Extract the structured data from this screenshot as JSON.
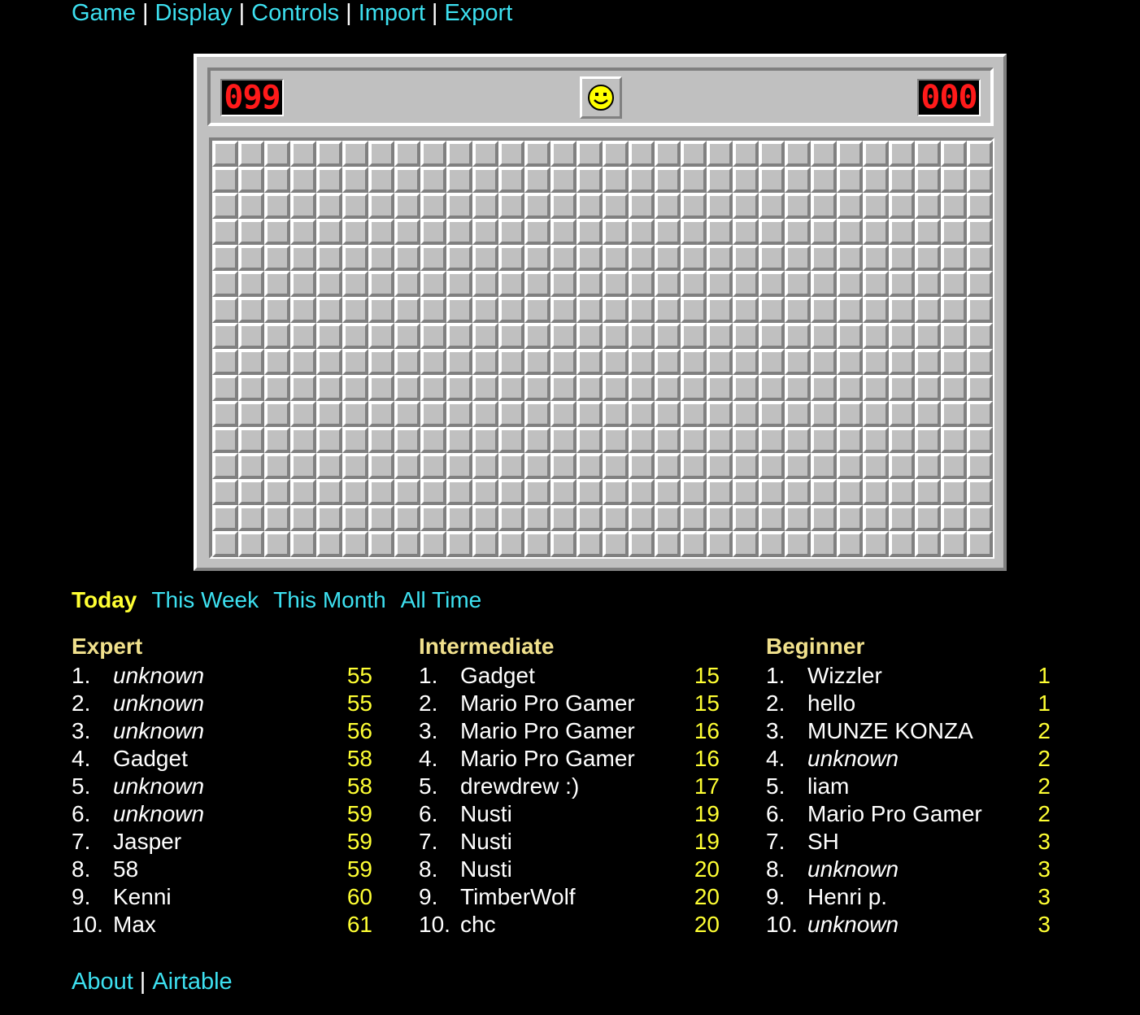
{
  "nav": {
    "items": [
      "Game",
      "Display",
      "Controls",
      "Import",
      "Export"
    ],
    "separator": "|"
  },
  "game": {
    "mines_counter": "099",
    "timer": "000",
    "face": "smiley-face-icon",
    "rows": 16,
    "cols": 30
  },
  "periods": {
    "today": "Today",
    "week": "This Week",
    "month": "This Month",
    "all": "All Time",
    "active": "Today"
  },
  "leaderboards": [
    {
      "title": "Expert",
      "entries": [
        {
          "rank": "1.",
          "name": "unknown",
          "time": "55",
          "unknown": true
        },
        {
          "rank": "2.",
          "name": "unknown",
          "time": "55",
          "unknown": true
        },
        {
          "rank": "3.",
          "name": "unknown",
          "time": "56",
          "unknown": true
        },
        {
          "rank": "4.",
          "name": "Gadget",
          "time": "58",
          "unknown": false
        },
        {
          "rank": "5.",
          "name": "unknown",
          "time": "58",
          "unknown": true
        },
        {
          "rank": "6.",
          "name": "unknown",
          "time": "59",
          "unknown": true
        },
        {
          "rank": "7.",
          "name": "Jasper",
          "time": "59",
          "unknown": false
        },
        {
          "rank": "8.",
          "name": "58",
          "time": "59",
          "unknown": false
        },
        {
          "rank": "9.",
          "name": "Kenni",
          "time": "60",
          "unknown": false
        },
        {
          "rank": "10.",
          "name": "Max",
          "time": "61",
          "unknown": false
        }
      ]
    },
    {
      "title": "Intermediate",
      "entries": [
        {
          "rank": "1.",
          "name": "Gadget",
          "time": "15",
          "unknown": false
        },
        {
          "rank": "2.",
          "name": "Mario Pro Gamer",
          "time": "15",
          "unknown": false
        },
        {
          "rank": "3.",
          "name": "Mario Pro Gamer",
          "time": "16",
          "unknown": false
        },
        {
          "rank": "4.",
          "name": "Mario Pro Gamer",
          "time": "16",
          "unknown": false
        },
        {
          "rank": "5.",
          "name": "drewdrew :)",
          "time": "17",
          "unknown": false
        },
        {
          "rank": "6.",
          "name": "Nusti",
          "time": "19",
          "unknown": false
        },
        {
          "rank": "7.",
          "name": "Nusti",
          "time": "19",
          "unknown": false
        },
        {
          "rank": "8.",
          "name": "Nusti",
          "time": "20",
          "unknown": false
        },
        {
          "rank": "9.",
          "name": "TimberWolf",
          "time": "20",
          "unknown": false
        },
        {
          "rank": "10.",
          "name": "chc",
          "time": "20",
          "unknown": false
        }
      ]
    },
    {
      "title": "Beginner",
      "entries": [
        {
          "rank": "1.",
          "name": "Wizzler",
          "time": "1",
          "unknown": false
        },
        {
          "rank": "2.",
          "name": "hello",
          "time": "1",
          "unknown": false
        },
        {
          "rank": "3.",
          "name": "MUNZE KONZA",
          "time": "2",
          "unknown": false
        },
        {
          "rank": "4.",
          "name": "unknown",
          "time": "2",
          "unknown": true
        },
        {
          "rank": "5.",
          "name": "liam",
          "time": "2",
          "unknown": false
        },
        {
          "rank": "6.",
          "name": "Mario Pro Gamer",
          "time": "2",
          "unknown": false
        },
        {
          "rank": "7.",
          "name": "SH",
          "time": "3",
          "unknown": false
        },
        {
          "rank": "8.",
          "name": "unknown",
          "time": "3",
          "unknown": true
        },
        {
          "rank": "9.",
          "name": "Henri p.",
          "time": "3",
          "unknown": false
        },
        {
          "rank": "10.",
          "name": "unknown",
          "time": "3",
          "unknown": true
        }
      ]
    }
  ],
  "footer": {
    "about": "About",
    "airtable": "Airtable",
    "separator": "|"
  },
  "colors": {
    "link": "#3de0f0",
    "time": "#ffff33",
    "heading": "#f0e08c",
    "counter": "#ff1a1a"
  }
}
